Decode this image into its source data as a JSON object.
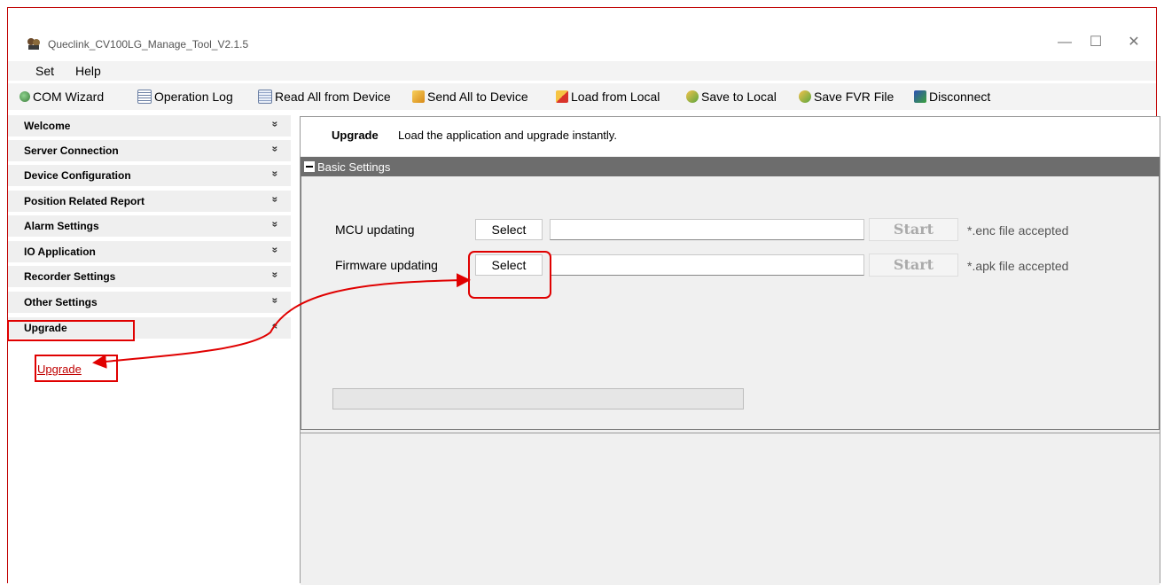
{
  "window": {
    "title": "Queclink_CV100LG_Manage_Tool_V2.1.5",
    "controls": {
      "minimize": "—",
      "maximize": "☐",
      "close": "✕"
    }
  },
  "menu": {
    "set": "Set",
    "help": "Help"
  },
  "toolbar": [
    {
      "label": "COM Wizard",
      "icon": "wizard-icon"
    },
    {
      "label": "Operation Log",
      "icon": "log-icon"
    },
    {
      "label": "Read All from Device",
      "icon": "read-icon"
    },
    {
      "label": "Send All to Device",
      "icon": "send-icon"
    },
    {
      "label": "Load from Local",
      "icon": "load-icon"
    },
    {
      "label": "Save to Local",
      "icon": "save-icon"
    },
    {
      "label": "Save FVR File",
      "icon": "save-fvr-icon"
    },
    {
      "label": "Disconnect",
      "icon": "disconnect-icon"
    }
  ],
  "sidebar": {
    "items": [
      {
        "label": "Welcome",
        "chevron": "»"
      },
      {
        "label": "Server Connection",
        "chevron": "»"
      },
      {
        "label": "Device Configuration",
        "chevron": "»"
      },
      {
        "label": "Position Related Report",
        "chevron": "»"
      },
      {
        "label": "Alarm Settings",
        "chevron": "»"
      },
      {
        "label": "IO Application",
        "chevron": "»"
      },
      {
        "label": "Recorder Settings",
        "chevron": "»"
      },
      {
        "label": "Other Settings",
        "chevron": "»"
      },
      {
        "label": "Upgrade",
        "chevron": "«"
      }
    ],
    "sublink": "Upgrade"
  },
  "main": {
    "title": "Upgrade",
    "description": "Load the application and upgrade instantly.",
    "section": "Basic Settings",
    "rows": [
      {
        "label": "MCU updating",
        "select": "Select",
        "value": "",
        "start": "Start",
        "hint": "*.enc file accepted"
      },
      {
        "label": "Firmware updating",
        "select": "Select",
        "value": "",
        "start": "Start",
        "hint": "*.apk file accepted"
      }
    ]
  },
  "colors": {
    "annotation": "#e00000",
    "section_bar": "#6d6d6d",
    "link": "#c00000"
  }
}
